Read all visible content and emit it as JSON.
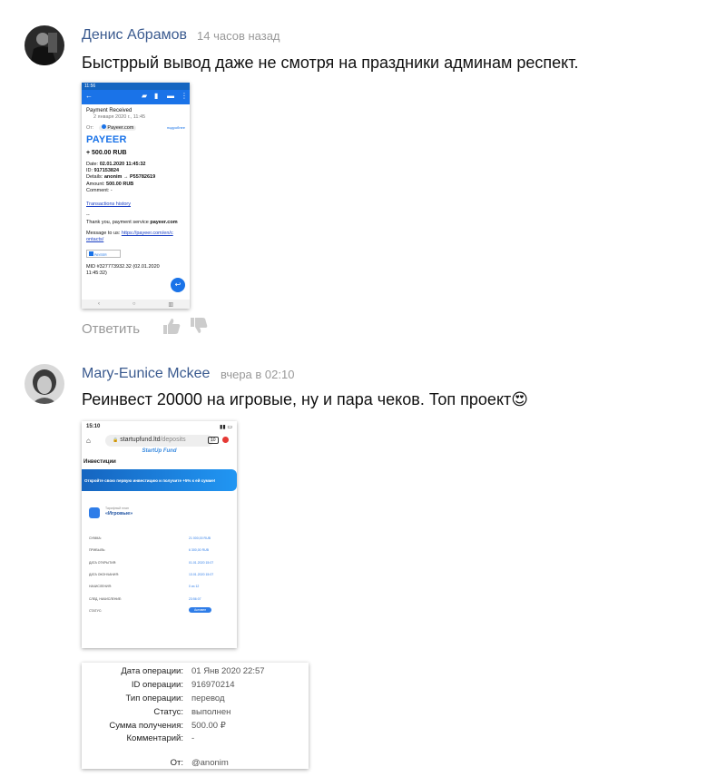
{
  "comments": [
    {
      "author": "Денис Абрамов",
      "time": "14 часов назад",
      "text": "Быстррый вывод даже не смотря на праздники админам респект.",
      "reply_label": "Ответить",
      "screenshot": {
        "status_time": "11:56",
        "subject": "Payment Received",
        "date": "2 января 2020 г., 11:45",
        "from_label": "От:",
        "from_name": "Payeer.com",
        "details_link": "подробнее",
        "brand": "PAYEER",
        "amount": "+ 500.00 RUB",
        "lines": [
          {
            "label": "Date:",
            "value": "02.01.2020 11:45:32"
          },
          {
            "label": "ID:",
            "value": "917153824"
          },
          {
            "label": "Details:",
            "value": "anonim → P55782619"
          },
          {
            "label": "Amount:",
            "value": "500.00 RUB"
          },
          {
            "label": "Comment:",
            "value": "-"
          }
        ],
        "history_link": "Transactions history",
        "separator": "--",
        "thanks_prefix": "Thank you, payment service",
        "thanks_name": "payeer.com",
        "message_prefix": "Message to us:",
        "message_link": "https://payeer.com/en/contacts/",
        "mid": "MID #327773932.32 (02.01.2020 11:45:32)",
        "badge": "PAYEER"
      }
    },
    {
      "author": "Mary-Eunice Mckee",
      "time": "вчера в 02:10",
      "text": "Реинвест 20000 на игровые, ну и пара чеков. Топ проект",
      "emoji": "😍",
      "screenshot": {
        "status_time": "15:10",
        "url_host": "startupfund.ltd",
        "url_path": "/deposits",
        "tab_count": "10",
        "logo": "StartUp Fund",
        "section": "Инвестиции",
        "banner": "Откройте свою первую инвестицию и получите +5% к ей сумме!",
        "plan_caption": "Тарифный план",
        "plan_name": "«Игровые»",
        "rows": [
          {
            "label": "СУММА:",
            "value": "21 000,00 RUB"
          },
          {
            "label": "ПРИБЫЛЬ:",
            "value": "6 300,00 RUB"
          },
          {
            "label": "ДАТА ОТКРЫТИЯ:",
            "value": "01.01.2020 15:07"
          },
          {
            "label": "ДАТА ОКОНЧАНИЯ:",
            "value": "13.01.2020 15:07"
          },
          {
            "label": "НАЧИСЛЕНИЯ:",
            "value": "0 из 12"
          },
          {
            "label": "СЛЕД. НАЧИСЛЕНИЕ:",
            "value": "23:56:07"
          }
        ],
        "status_label": "СТАТУС:",
        "status_value": "Активен"
      },
      "details": [
        {
          "label": "Дата операции:",
          "value": "01 Янв 2020 22:57"
        },
        {
          "label": "ID операции:",
          "value": "916970214"
        },
        {
          "label": "Тип операции:",
          "value": "перевод"
        },
        {
          "label": "Статус:",
          "value": "выполнен"
        },
        {
          "label": "Сумма получения:",
          "value": "500.00 ₽"
        },
        {
          "label": "Комментарий:",
          "value": "-"
        },
        {
          "label": "От:",
          "value": "@anonim"
        }
      ]
    }
  ]
}
